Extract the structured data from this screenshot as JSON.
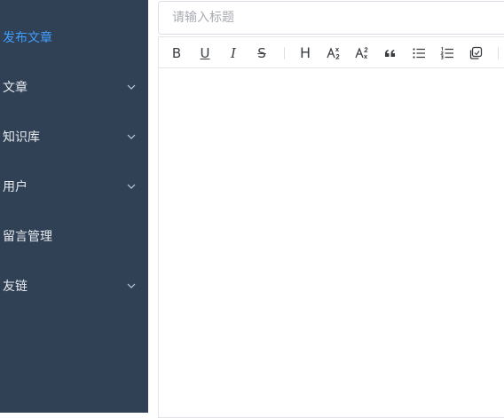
{
  "sidebar": {
    "items": [
      {
        "label": "发布文章",
        "active": true,
        "has_submenu": false
      },
      {
        "label": "文章",
        "active": false,
        "has_submenu": true
      },
      {
        "label": "知识库",
        "active": false,
        "has_submenu": true
      },
      {
        "label": "用户",
        "active": false,
        "has_submenu": true
      },
      {
        "label": "留言管理",
        "active": false,
        "has_submenu": false
      },
      {
        "label": "友链",
        "active": false,
        "has_submenu": true
      }
    ]
  },
  "editor": {
    "title_placeholder": "请输入标题",
    "title_value": "",
    "toolbar": {
      "bold_glyph": "B",
      "underline_glyph": "U",
      "italic_glyph": "I",
      "strike_glyph": "S",
      "heading_glyph": "H",
      "subscript_icon": "subscript-icon",
      "superscript_icon": "superscript-icon",
      "quote_icon": "quote-icon",
      "bullet_list_icon": "bullet-list-icon",
      "ordered_list_icon": "ordered-list-icon",
      "copy_icon": "copy-icon"
    }
  },
  "colors": {
    "sidebar_bg": "#304156",
    "active_menu": "#409eff",
    "menu_text": "#e8ecf1"
  }
}
